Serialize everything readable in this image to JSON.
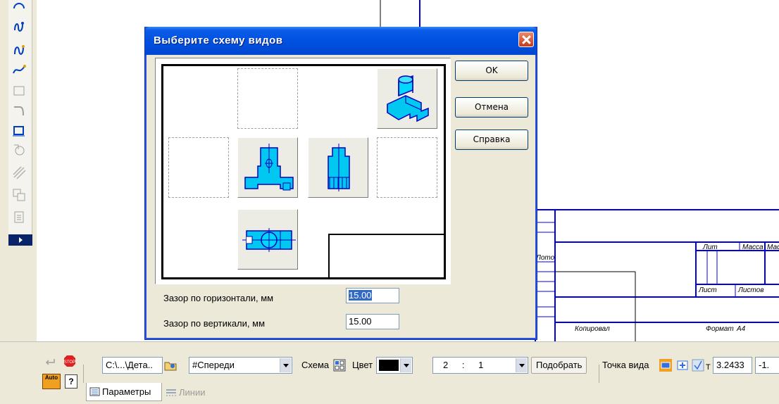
{
  "dialog": {
    "title": "Выберите схему видов",
    "buttons": {
      "ok": "OK",
      "cancel": "Отмена",
      "help": "Справка"
    },
    "fields": {
      "horizontal_gap_label": "Зазор по горизонтали, мм",
      "horizontal_gap_value": "15.00",
      "vertical_gap_label": "Зазор по вертикали, мм",
      "vertical_gap_value": "15.00"
    }
  },
  "title_block": {
    "col_lit": "Лит",
    "col_mass": "Масса",
    "col_scale": "Мас",
    "sheet": "Лист",
    "sheets": "Листов",
    "copied": "Копировал",
    "format": "Формат",
    "format_value": "А4",
    "left_label": "Лото"
  },
  "property_bar": {
    "path": "C:\\...\\Дета..",
    "orientation": "#Спереди",
    "scheme_label": "Схема",
    "color_label": "Цвет",
    "color_value": "#000000",
    "scale_num": "2",
    "scale_sep": ":",
    "scale_den": "1",
    "fit_button": "Подобрать",
    "viewpoint_label": "Точка вида",
    "t_label": "Т",
    "x_value": "3.2433",
    "y_value": "-1.",
    "tabs": {
      "parameters": "Параметры",
      "lines": "Линии"
    },
    "auto_label": "Auto"
  }
}
